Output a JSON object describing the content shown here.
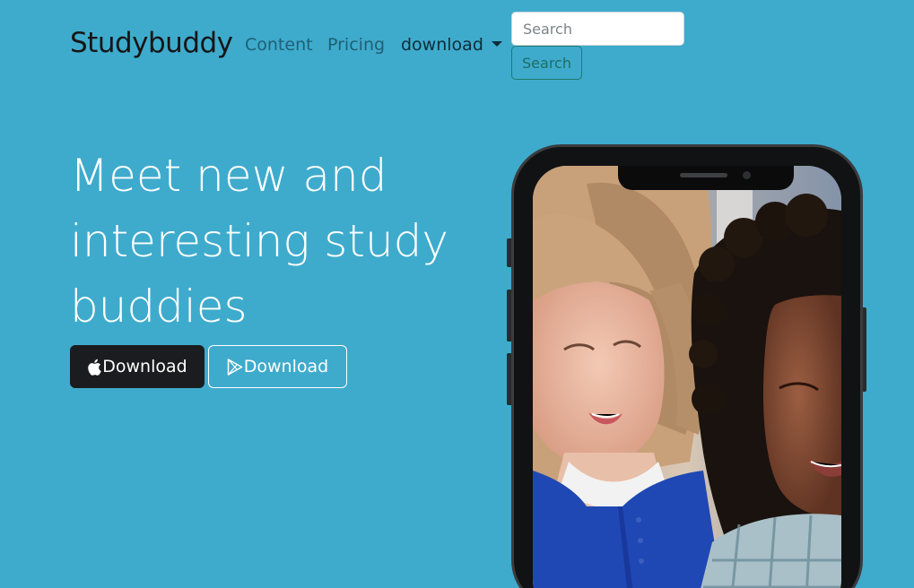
{
  "nav": {
    "brand": "Studybuddy",
    "links": [
      {
        "label": "Content"
      },
      {
        "label": "Pricing"
      },
      {
        "label": "download"
      }
    ],
    "search": {
      "placeholder": "Search",
      "value": "",
      "button_label": "Search"
    }
  },
  "hero": {
    "title_lines": [
      "Meet new and",
      "interesting study",
      "buddies"
    ],
    "apple_button_label": "Download",
    "play_button_label": "Download"
  },
  "icons": {
    "apple": "apple-icon",
    "play": "google-play-icon",
    "caret": "chevron-down-icon"
  },
  "colors": {
    "background": "#3eabcd",
    "apple_button": "#1b1c1f",
    "search_button_border": "#1e7a6c"
  }
}
